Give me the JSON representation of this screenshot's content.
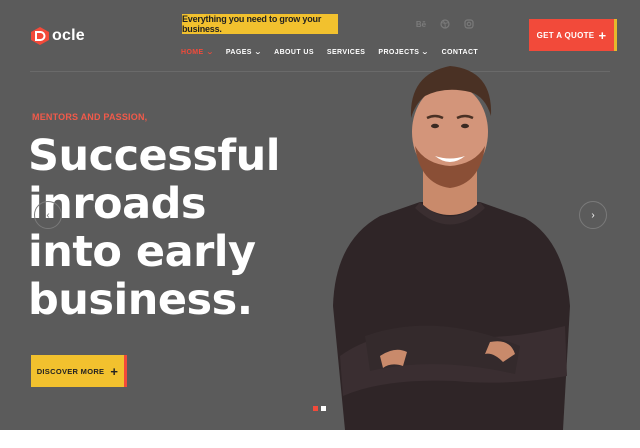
{
  "brand": {
    "name": "ocle",
    "logo_color": "#f24a3a"
  },
  "tagline": "Everything you need to grow your business.",
  "socials": [
    {
      "icon": "behance-icon",
      "glyph": "Bē"
    },
    {
      "icon": "dribbble-icon",
      "glyph": "◎"
    },
    {
      "icon": "instagram-icon",
      "glyph": "◎"
    }
  ],
  "quote_button": {
    "label": "GET A QUOTE",
    "icon": "plus-icon"
  },
  "nav": {
    "items": [
      {
        "label": "HOME",
        "dropdown": true,
        "active": true
      },
      {
        "label": "PAGES",
        "dropdown": true,
        "active": false
      },
      {
        "label": "ABOUT US",
        "dropdown": false,
        "active": false
      },
      {
        "label": "SERVICES",
        "dropdown": false,
        "active": false
      },
      {
        "label": "PROJECTS",
        "dropdown": true,
        "active": false
      },
      {
        "label": "CONTACT",
        "dropdown": false,
        "active": false
      }
    ]
  },
  "hero": {
    "kicker": "MENTORS AND PASSION,",
    "headline_lines": [
      "Successful",
      "inroads",
      "into early",
      "business."
    ],
    "cta_label": "DISCOVER MORE",
    "cta_icon": "plus-icon"
  },
  "slider": {
    "prev_icon": "chevron-left-icon",
    "next_icon": "chevron-right-icon",
    "slides_total": 2,
    "active_slide": 1
  },
  "colors": {
    "accent_red": "#f24a3a",
    "accent_yellow": "#f2c12e",
    "background": "#5b5b5b"
  }
}
